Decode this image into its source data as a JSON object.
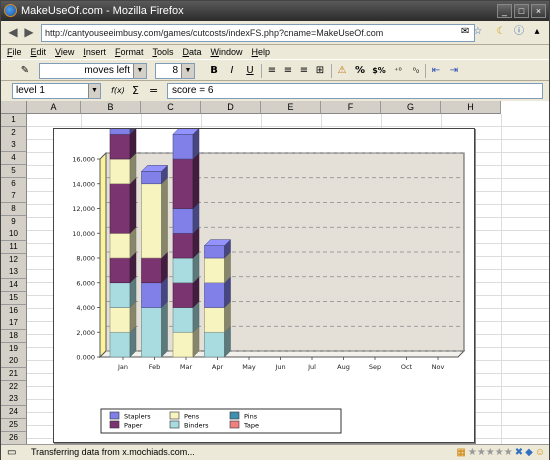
{
  "window": {
    "title": "MakeUseOf.com - Mozilla Firefox"
  },
  "browser": {
    "url": "http://cantyouseeimbusy.com/games/cutcosts/indexFS.php?cname=MakeUseOf.com"
  },
  "menu": {
    "items": [
      "File",
      "Edit",
      "View",
      "Insert",
      "Format",
      "Tools",
      "Data",
      "Window",
      "Help"
    ]
  },
  "toolbar": {
    "font_value": "moves left",
    "size_value": "8",
    "bold": "B",
    "italic": "I",
    "underline": "U",
    "percent": "%",
    "currency": "$%"
  },
  "formula_bar": {
    "name_box": "level 1",
    "fx": "f(x)",
    "sigma": "Σ",
    "equals": "=",
    "formula": "score =  6"
  },
  "sheet": {
    "columns": [
      "A",
      "B",
      "C",
      "D",
      "E",
      "F",
      "G",
      "H"
    ],
    "rows": [
      "1",
      "2",
      "3",
      "4",
      "5",
      "6",
      "7",
      "8",
      "9",
      "10",
      "11",
      "12",
      "13",
      "14",
      "15",
      "16",
      "17",
      "18",
      "19",
      "20",
      "21",
      "22",
      "23",
      "24",
      "25",
      "26"
    ]
  },
  "chart_data": {
    "type": "bar",
    "stacked": true,
    "three_d": true,
    "categories": [
      "Jan",
      "Feb",
      "Mar",
      "Apr",
      "May",
      "Jun",
      "Jul",
      "Aug",
      "Sep",
      "Oct",
      "Nov"
    ],
    "yticks": [
      "0.000",
      "2,000",
      "4,000",
      "6,000",
      "8,000",
      "10,000",
      "12,000",
      "14,000",
      "16,000"
    ],
    "ylim": [
      0,
      16000
    ],
    "grid": true,
    "legend_position": "bottom",
    "series": [
      {
        "name": "Staplers",
        "color": "#8080e8",
        "values": [
          1000,
          2000,
          1000,
          1000
        ]
      },
      {
        "name": "Paper",
        "color": "#7a3570",
        "values": [
          6000,
          2000,
          8000,
          2000
        ]
      },
      {
        "name": "Pens",
        "color": "#f8f4c0",
        "values": [
          3500,
          6000,
          4000,
          3000
        ]
      },
      {
        "name": "Binders",
        "color": "#a8dce0",
        "values": [
          4000,
          2500,
          2000,
          2000
        ]
      },
      {
        "name": "Pins",
        "color": "#3f8fb0",
        "values": [
          0,
          0,
          0,
          0
        ]
      },
      {
        "name": "Tape",
        "color": "#f08080",
        "values": [
          0,
          0,
          0,
          0
        ]
      }
    ],
    "segments": [
      [
        [
          "Binders",
          2000
        ],
        [
          "Pens",
          2000
        ],
        [
          "Binders",
          2000
        ],
        [
          "Paper",
          2000
        ],
        [
          "Pens",
          2000
        ],
        [
          "Paper",
          4000
        ],
        [
          "Pens",
          2000
        ],
        [
          "Paper",
          2000
        ],
        [
          "Staplers",
          2000
        ]
      ],
      [
        [
          "Binders",
          4000
        ],
        [
          "Staplers",
          2000
        ],
        [
          "Paper",
          2000
        ],
        [
          "Pens",
          6000
        ],
        [
          "Staplers",
          1000
        ]
      ],
      [
        [
          "Pens",
          2000
        ],
        [
          "Binders",
          2000
        ],
        [
          "Paper",
          2000
        ],
        [
          "Binders",
          2000
        ],
        [
          "Paper",
          2000
        ],
        [
          "Staplers",
          2000
        ],
        [
          "Paper",
          4000
        ],
        [
          "Staplers",
          2000
        ]
      ],
      [
        [
          "Binders",
          2000
        ],
        [
          "Pens",
          2000
        ],
        [
          "Staplers",
          2000
        ],
        [
          "Pens",
          2000
        ],
        [
          "Staplers",
          1000
        ]
      ]
    ]
  },
  "status": {
    "text": "Transferring data from x.mochiads.com..."
  }
}
